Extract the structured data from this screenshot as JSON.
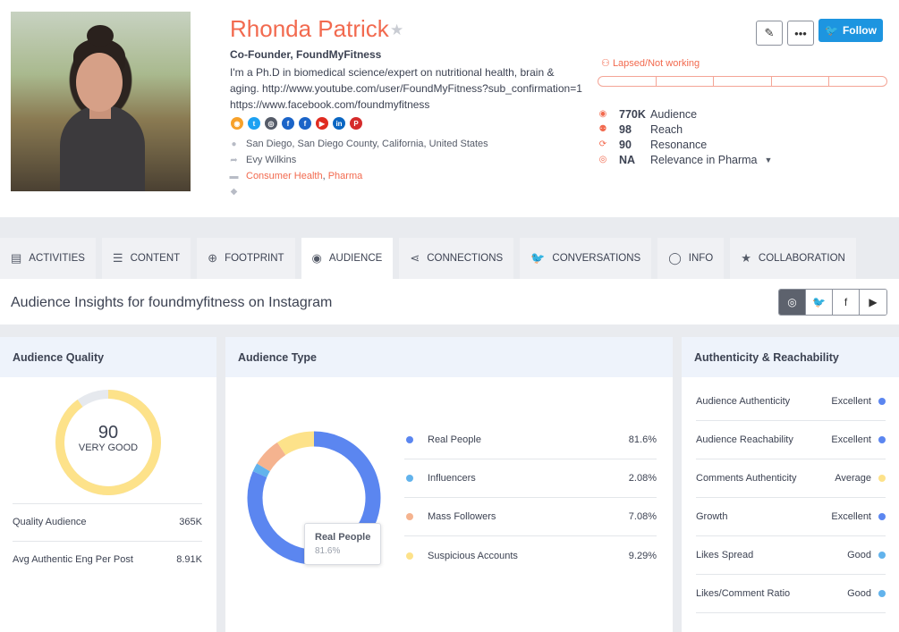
{
  "profile": {
    "name": "Rhonda Patrick",
    "title": "Co-Founder, FoundMyFitness",
    "bio": "I'm a Ph.D in biomedical science/expert on nutritional health, brain & aging. http://www.youtube.com/user/FoundMyFitness?sub_confirmation=1 https://www.facebook.com/foundmyfitness",
    "location": "San Diego, San Diego County, California, United States",
    "contact": "Evy Wilkins",
    "category_1": "Consumer Health",
    "category_sep": ", ",
    "category_2": "Pharma",
    "social_icons": [
      "rss-icon",
      "twitter-icon",
      "instagram-icon",
      "facebook-icon",
      "facebook-icon",
      "youtube-icon",
      "linkedin-icon",
      "pinterest-icon"
    ]
  },
  "actions": {
    "follow_label": "Follow",
    "more_label": "•••"
  },
  "status": {
    "label": "Lapsed/Not working"
  },
  "stats": [
    {
      "icon": "eye-icon",
      "value": "770K",
      "label": "Audience"
    },
    {
      "icon": "users-icon",
      "value": "98",
      "label": "Reach"
    },
    {
      "icon": "refresh-icon",
      "value": "90",
      "label": "Resonance"
    },
    {
      "icon": "target-icon",
      "value": "NA",
      "label": "Relevance in Pharma"
    }
  ],
  "tabs": [
    {
      "label": "ACTIVITIES",
      "icon": "activities-icon"
    },
    {
      "label": "CONTENT",
      "icon": "list-icon"
    },
    {
      "label": "FOOTPRINT",
      "icon": "globe-icon"
    },
    {
      "label": "AUDIENCE",
      "icon": "eye-icon"
    },
    {
      "label": "CONNECTIONS",
      "icon": "share-icon"
    },
    {
      "label": "CONVERSATIONS",
      "icon": "twitter-icon"
    },
    {
      "label": "INFO",
      "icon": "user-icon"
    },
    {
      "label": "COLLABORATION",
      "icon": "star-icon"
    }
  ],
  "insights": {
    "title": "Audience Insights for foundmyfitness on Instagram",
    "platforms": [
      "instagram-icon",
      "twitter-icon",
      "facebook-icon",
      "youtube-icon"
    ]
  },
  "quality": {
    "heading": "Audience Quality",
    "score": "90",
    "score_label": "VERY GOOD",
    "score_fraction": 0.9,
    "rows": [
      {
        "label": "Quality Audience",
        "value": "365K"
      },
      {
        "label": "Avg Authentic Eng Per Post",
        "value": "8.91K"
      }
    ]
  },
  "audience_type": {
    "heading": "Audience Type",
    "tooltip_title": "Real People",
    "tooltip_value": "81.6%",
    "rows": [
      {
        "label": "Real People",
        "value": "81.6%",
        "color": "#5b86f0"
      },
      {
        "label": "Influencers",
        "value": "2.08%",
        "color": "#62b3ec"
      },
      {
        "label": "Mass Followers",
        "value": "7.08%",
        "color": "#f5b38f"
      },
      {
        "label": "Suspicious Accounts",
        "value": "9.29%",
        "color": "#fde28a"
      }
    ]
  },
  "chart_data": {
    "type": "pie",
    "categories": [
      "Real People",
      "Influencers",
      "Mass Followers",
      "Suspicious Accounts"
    ],
    "values": [
      81.6,
      2.08,
      7.08,
      9.29
    ],
    "colors": [
      "#5b86f0",
      "#62b3ec",
      "#f5b38f",
      "#fde28a"
    ]
  },
  "authenticity": {
    "heading": "Authenticity & Reachability",
    "rows": [
      {
        "label": "Audience Authenticity",
        "value": "Excellent",
        "color": "#5b86f0"
      },
      {
        "label": "Audience Reachability",
        "value": "Excellent",
        "color": "#5b86f0"
      },
      {
        "label": "Comments Authenticity",
        "value": "Average",
        "color": "#fde28a"
      },
      {
        "label": "Growth",
        "value": "Excellent",
        "color": "#5b86f0"
      },
      {
        "label": "Likes Spread",
        "value": "Good",
        "color": "#62b3ec"
      },
      {
        "label": "Likes/Comment Ratio",
        "value": "Good",
        "color": "#62b3ec"
      }
    ]
  }
}
